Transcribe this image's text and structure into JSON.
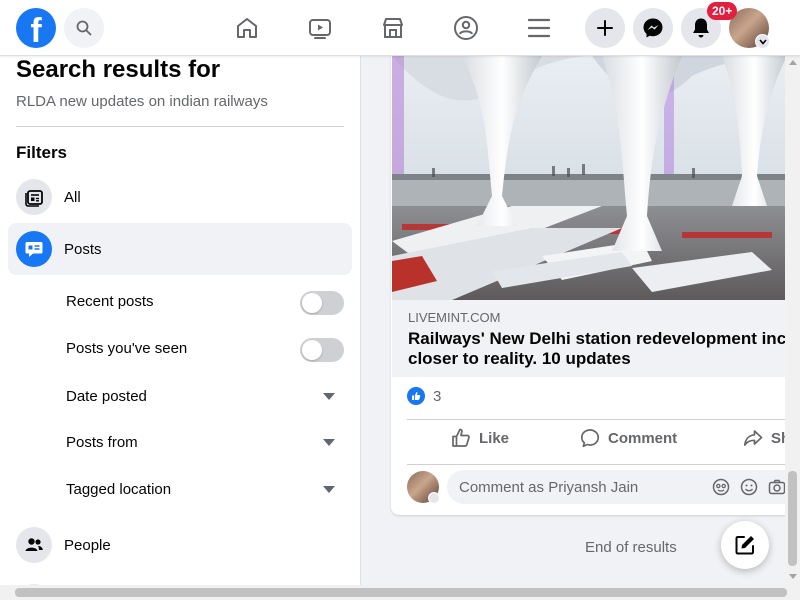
{
  "header": {
    "logo_icon": "facebook-logo",
    "logo_letter": "f",
    "notifications_badge": "20+",
    "nav_icons": [
      "home-icon",
      "watch-icon",
      "marketplace-icon",
      "groups-icon",
      "menu-icon"
    ],
    "action_icons": [
      "create-icon",
      "messenger-icon",
      "notifications-icon",
      "account-icon"
    ]
  },
  "sidebar": {
    "title": "Search results for",
    "query": "RLDA new updates on indian railways",
    "filters_heading": "Filters",
    "filter_all": "All",
    "filter_posts": "Posts",
    "sub_filters": {
      "recent_posts": "Recent posts",
      "posts_seen": "Posts you've seen",
      "date_posted": "Date posted",
      "posts_from": "Posts from",
      "tagged_location": "Tagged location"
    },
    "filter_people": "People"
  },
  "post": {
    "link_domain": "LIVEMINT.COM",
    "link_title_line1": "Railways' New Delhi station redevelopment inc",
    "link_title_line2": "closer to reality. 10 updates",
    "reaction_count": "3",
    "actions": {
      "like": "Like",
      "comment": "Comment",
      "share": "Sh"
    },
    "comment_placeholder": "Comment as Priyansh Jain"
  },
  "feed": {
    "end_text": "End of results"
  },
  "colors": {
    "brand": "#1877f2",
    "badge": "#e41e3f",
    "background": "#f0f2f5"
  }
}
